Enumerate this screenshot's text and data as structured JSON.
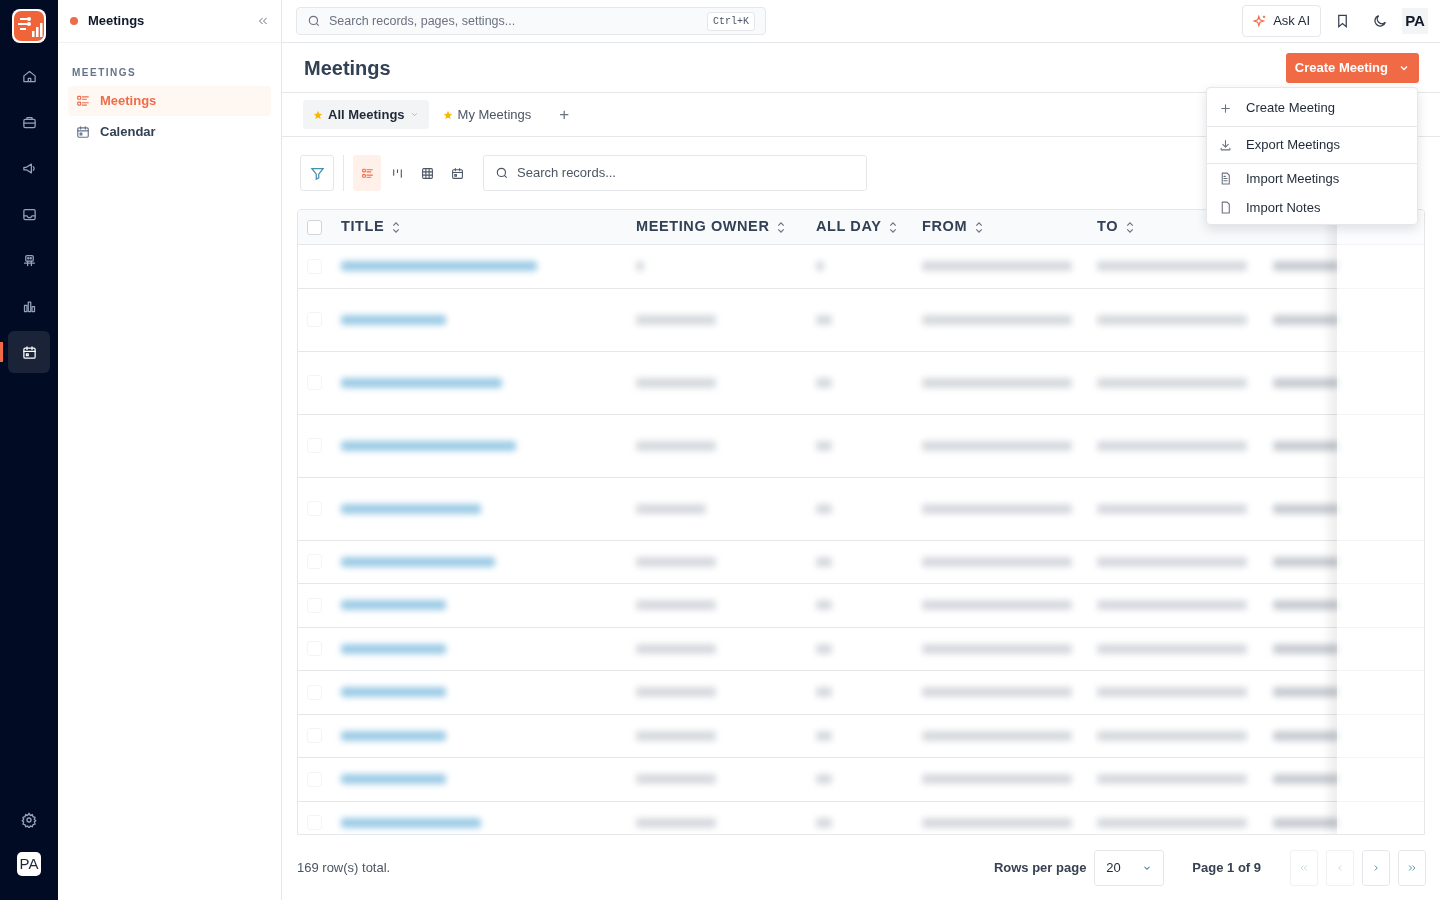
{
  "rail": {
    "items": [
      {
        "selected": false
      },
      {
        "selected": false
      },
      {
        "selected": false
      },
      {
        "selected": false
      },
      {
        "selected": false
      },
      {
        "selected": false
      },
      {
        "selected": true
      }
    ],
    "avatar": "PA"
  },
  "sidebar": {
    "title": "Meetings",
    "section": "MEETINGS",
    "items": [
      {
        "label": "Meetings",
        "selected": true
      },
      {
        "label": "Calendar",
        "selected": false
      }
    ]
  },
  "topbar": {
    "search_placeholder": "Search records, pages, settings...",
    "shortcut": "Ctrl+K",
    "ask_ai": "Ask AI",
    "avatar": "PA"
  },
  "page": {
    "title": "Meetings",
    "create_button": "Create Meeting"
  },
  "views": [
    {
      "label": "All Meetings",
      "selected": true
    },
    {
      "label": "My Meetings",
      "selected": false
    }
  ],
  "add_view": "+",
  "toolbar": {
    "layouts": [
      {
        "selected": true
      },
      {
        "selected": false
      },
      {
        "selected": false
      },
      {
        "selected": false
      }
    ],
    "search_placeholder": "Search records..."
  },
  "table": {
    "all_checked": false,
    "columns": [
      "TITLE",
      "MEETING OWNER",
      "ALL DAY",
      "FROM",
      "TO"
    ],
    "rows": [
      {
        "kind": "redacted",
        "checked": false
      },
      {
        "kind": "redacted",
        "checked": false
      },
      {
        "kind": "redacted",
        "checked": false
      },
      {
        "kind": "redacted",
        "checked": false
      },
      {
        "kind": "redacted",
        "checked": false
      },
      {
        "kind": "redacted",
        "checked": false
      },
      {
        "kind": "redacted",
        "checked": false
      },
      {
        "kind": "redacted",
        "checked": false
      },
      {
        "kind": "redacted",
        "checked": false
      },
      {
        "kind": "redacted",
        "checked": false
      },
      {
        "kind": "redacted",
        "checked": false
      },
      {
        "kind": "redacted",
        "checked": false
      }
    ]
  },
  "footer": {
    "total": "169 row(s) total.",
    "rows_per_page_label": "Rows per page",
    "rows_per_page": "20",
    "page": "Page 1 of 9"
  },
  "menu": {
    "items": [
      {
        "label": "Create Meeting"
      },
      {
        "label": "Export Meetings"
      },
      {
        "label": "Import Meetings"
      },
      {
        "label": "Import Notes"
      }
    ]
  }
}
